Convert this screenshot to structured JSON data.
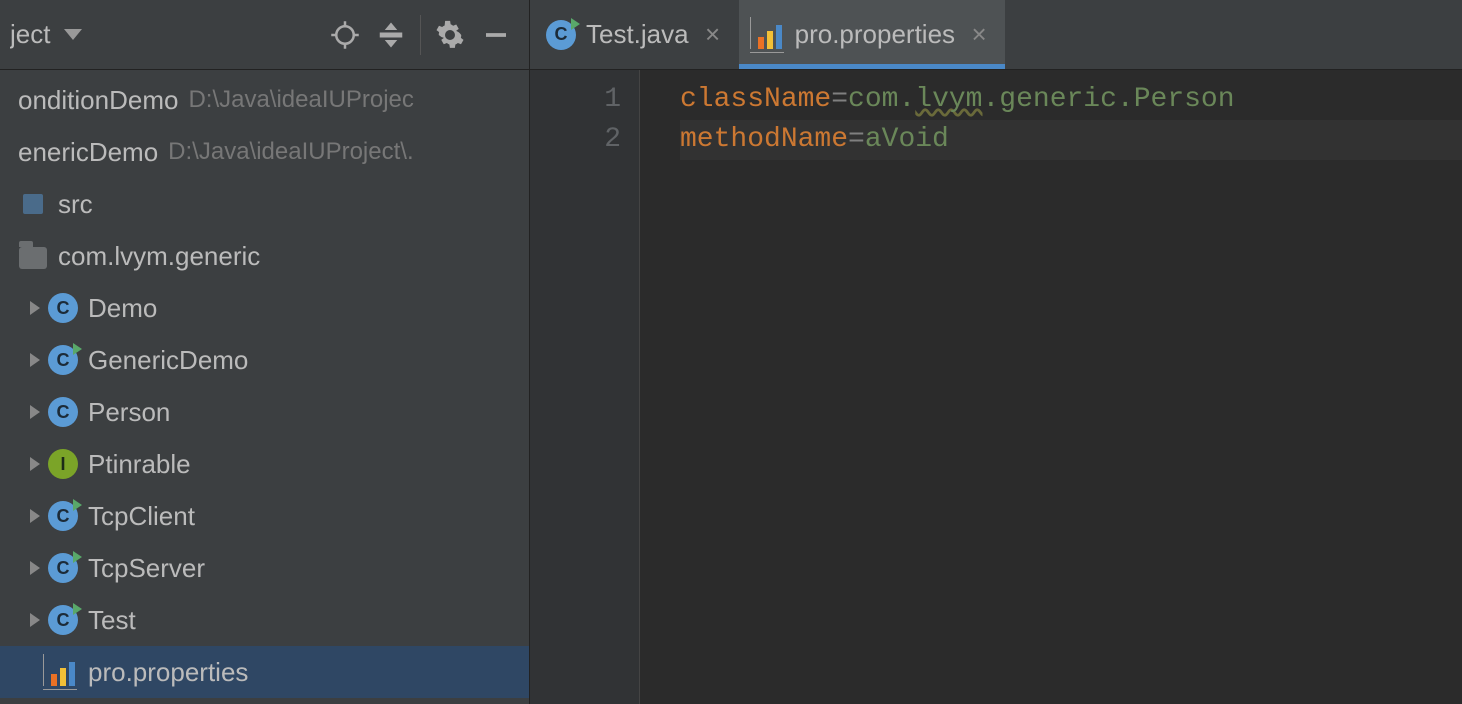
{
  "projectPanel": {
    "title": "ject",
    "modules": [
      {
        "name": "onditionDemo",
        "path": "D:\\Java\\ideaIUProjec"
      },
      {
        "name": "enericDemo",
        "path": "D:\\Java\\ideaIUProject\\."
      }
    ],
    "srcLabel": "src",
    "packageLabel": "com.lvym.generic",
    "items": [
      {
        "label": "Demo",
        "icon": "class",
        "runnable": false
      },
      {
        "label": "GenericDemo",
        "icon": "class",
        "runnable": true
      },
      {
        "label": "Person",
        "icon": "class",
        "runnable": false
      },
      {
        "label": "Ptinrable",
        "icon": "interface",
        "runnable": false
      },
      {
        "label": "TcpClient",
        "icon": "class",
        "runnable": true
      },
      {
        "label": "TcpServer",
        "icon": "class",
        "runnable": true
      },
      {
        "label": "Test",
        "icon": "class",
        "runnable": true
      },
      {
        "label": "pro.properties",
        "icon": "props",
        "runnable": false,
        "selected": true,
        "noCaret": true
      }
    ]
  },
  "tabs": [
    {
      "label": "Test.java",
      "icon": "class-runnable",
      "active": false
    },
    {
      "label": "pro.properties",
      "icon": "props",
      "active": true
    }
  ],
  "editor": {
    "lines": [
      {
        "n": "1",
        "key": "className",
        "eq": "=",
        "val": "com.lvym.generic.Person",
        "wavy": "lvym"
      },
      {
        "n": "2",
        "key": "methodName",
        "eq": "=",
        "val": "aVoid",
        "current": true
      }
    ]
  }
}
